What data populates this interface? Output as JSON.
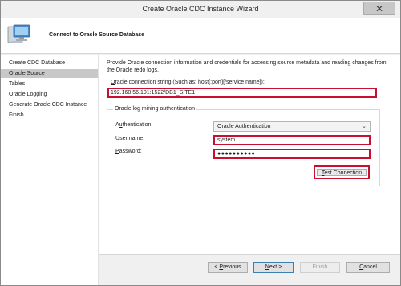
{
  "window": {
    "title": "Create Oracle CDC Instance Wizard",
    "close_glyph": "✕"
  },
  "header": {
    "title": "Connect to Oracle Source Database",
    "icon": "computer-monitor-icon"
  },
  "nav": {
    "items": [
      {
        "label": "Create CDC Database",
        "active": false
      },
      {
        "label": "Oracle Source",
        "active": true
      },
      {
        "label": "Tables",
        "active": false
      },
      {
        "label": "Oracle Logging",
        "active": false
      },
      {
        "label": "Generate Oracle CDC Instance",
        "active": false
      },
      {
        "label": "Finish",
        "active": false
      }
    ]
  },
  "main": {
    "description": "Provide Oracle connection information and credentials for accessing source metadata and reading changes from the Oracle redo logs.",
    "connection_label_mnemonic": "O",
    "connection_label_rest": "racle connection string (Such as: host[:port][/service name]):",
    "connection_value": "192.168.56.101:1522/DB1_SITE1",
    "group_title": "Oracle log mining authentication",
    "auth_label_pre": "A",
    "auth_label_mnemonic": "u",
    "auth_label_rest": "thentication:",
    "auth_value": "Oracle Authentication",
    "user_label_mnemonic": "U",
    "user_label_rest": "ser name:",
    "user_value": "system",
    "password_label_mnemonic": "P",
    "password_label_rest": "assword:",
    "password_value": "●●●●●●●●●●",
    "test_button_mnemonic": "T",
    "test_button_rest": "est Connection"
  },
  "footer": {
    "previous_prefix": "< ",
    "previous_mnemonic": "P",
    "previous_rest": "revious",
    "next_mnemonic": "N",
    "next_rest": "ext >",
    "finish_label": "Finish",
    "cancel_mnemonic": "C",
    "cancel_rest": "ancel"
  },
  "colors": {
    "highlight_red": "#c8102e",
    "nav_active": "#c8c8c8"
  }
}
